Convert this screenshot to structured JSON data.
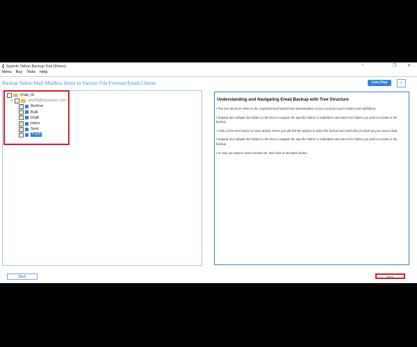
{
  "window": {
    "title": "Sysinfo Yahoo Backup Tool (Demo)",
    "minimize": "–",
    "maximize": "❐",
    "close": "✕"
  },
  "menu": [
    "Menu",
    "Buy",
    "Tools",
    "Help"
  ],
  "heading": "Backup Yahoo Mail Mailbox Items to Various File Formats/Email Clients",
  "live_chat": "Live Chat",
  "hamburger": "≡",
  "tree": {
    "root": "Imap_Id",
    "account": "ami25@myyahoo.com",
    "folders": [
      "Archive",
      "Bulk",
      "Draft",
      "Inbox",
      "Sent",
      "Trash"
    ],
    "selected": "Trash"
  },
  "info": {
    "title": "Understanding and Navigating Email Backup with Tree Structure",
    "bullets": [
      "• The tree structure refers to the organized and hierarchical representation of your email account's folders and subfolders.",
      "• Expand and collapse the folders in the tree to navigate the specific folders or subfolders and select the folders you wish to include in the backup.",
      "• Click on the Next button to move ahead, where you will find the options to select file format and email client to back up your source data.",
      "• Expand and collapse the folders in the tree to navigate the specific folders or subfolders and select the folders you wish to include in the backup.",
      "• In case you want to select another ID, then click on the Back button."
    ]
  },
  "buttons": {
    "back": "Back",
    "next": "Next"
  }
}
